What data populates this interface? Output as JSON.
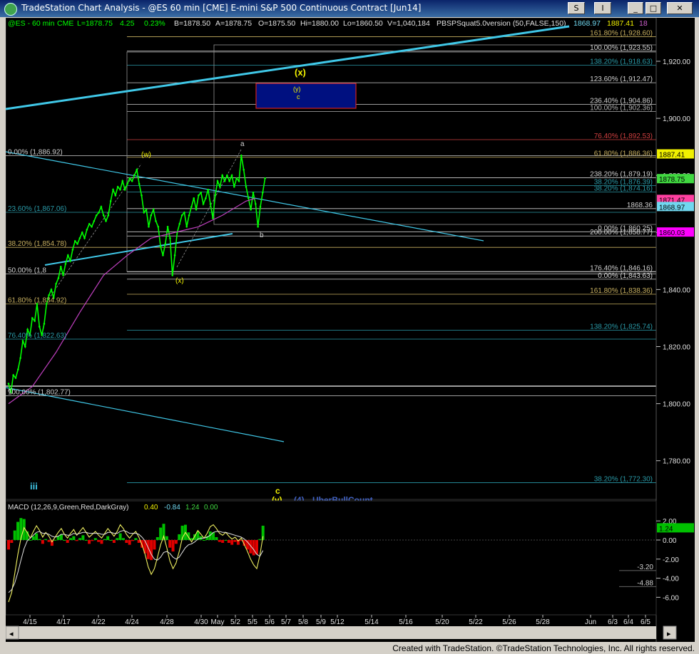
{
  "window": {
    "title": "TradeStation Chart Analysis - @ES 60 min [CME] E-mini S&P 500 Continuous Contract [Jun14]",
    "buttons": {
      "s": "S",
      "i": "I",
      "minimize": "_",
      "restore": "□",
      "close": "✕"
    }
  },
  "header": {
    "symbol": "@ES - 60 min",
    "exchange": "CME",
    "last": "L=1878.75",
    "change": "4.25",
    "pct": "0.23%",
    "bid": "B=1878.50",
    "ask": "A=1878.75",
    "open": "O=1875.50",
    "high": "Hi=1880.00",
    "low": "Lo=1860.50",
    "volume": "V=1,040,184",
    "indicator": "PBSPSquat5.0version (50,FALSE,150)",
    "r1": "1868.97",
    "r2": "1887.41",
    "r3": "18"
  },
  "footer": "Created with TradeStation. ©TradeStation Technologies, Inc. All rights reserved.",
  "colors": {
    "bg": "#000000",
    "price": "#00ff00",
    "cyan": "#40c8e8",
    "fib": "#2a9aa8",
    "tan": "#d4c890",
    "magenta": "#c040c0",
    "yellow": "#f0f000",
    "navy": "#001080"
  },
  "chart_data": [
    {
      "type": "line",
      "title": "@ES - 60 min",
      "x_tick_labels": [
        "4/15",
        "4/17",
        "4/22",
        "4/24",
        "4/28",
        "4/30",
        "May",
        "5/2",
        "5/5",
        "5/6",
        "5/7",
        "5/8",
        "5/9",
        "5/12",
        "5/14",
        "5/16",
        "5/20",
        "5/22",
        "5/26",
        "5/28",
        "Jun",
        "6/3",
        "6/4",
        "6/5"
      ],
      "y_axis": {
        "ylim": [
          1766,
          1932
        ],
        "ticks": [
          "1,920.00",
          "1,900.00",
          "1,880.00",
          "1,860.00",
          "1,840.00",
          "1,820.00",
          "1,800.00",
          "1,780.00"
        ]
      },
      "series": [
        {
          "name": "@ES 60 min",
          "points": [
            [
              0,
              1807
            ],
            [
              1,
              1804
            ],
            [
              2,
              1810
            ],
            [
              3,
              1809
            ],
            [
              4,
              1812
            ],
            [
              5,
              1816
            ],
            [
              6,
              1822
            ],
            [
              7,
              1820
            ],
            [
              8,
              1826
            ],
            [
              9,
              1824
            ],
            [
              10,
              1830
            ],
            [
              11,
              1829
            ],
            [
              12,
              1835
            ],
            [
              13,
              1827
            ],
            [
              14,
              1824
            ],
            [
              15,
              1828
            ],
            [
              16,
              1835
            ],
            [
              17,
              1838
            ],
            [
              18,
              1840
            ],
            [
              19,
              1837
            ],
            [
              20,
              1842
            ],
            [
              21,
              1844
            ],
            [
              22,
              1848
            ],
            [
              23,
              1845
            ],
            [
              24,
              1849
            ],
            [
              25,
              1852
            ],
            [
              26,
              1850
            ],
            [
              27,
              1854
            ],
            [
              28,
              1857
            ],
            [
              29,
              1856
            ],
            [
              30,
              1858
            ],
            [
              31,
              1860
            ],
            [
              32,
              1858
            ],
            [
              33,
              1861
            ],
            [
              34,
              1863
            ],
            [
              35,
              1862
            ],
            [
              36,
              1864
            ],
            [
              37,
              1866
            ],
            [
              38,
              1867
            ],
            [
              39,
              1869
            ],
            [
              40,
              1866
            ],
            [
              41,
              1864
            ],
            [
              42,
              1866
            ],
            [
              43,
              1871
            ],
            [
              44,
              1875
            ],
            [
              45,
              1873
            ],
            [
              46,
              1876
            ],
            [
              47,
              1875
            ],
            [
              48,
              1878
            ],
            [
              49,
              1875
            ],
            [
              50,
              1877
            ],
            [
              51,
              1879
            ],
            [
              52,
              1878
            ],
            [
              53,
              1880
            ],
            [
              54,
              1882
            ],
            [
              55,
              1877
            ],
            [
              56,
              1873
            ],
            [
              57,
              1867
            ],
            [
              58,
              1868
            ],
            [
              59,
              1862
            ],
            [
              60,
              1866
            ],
            [
              61,
              1868
            ],
            [
              62,
              1864
            ],
            [
              63,
              1862
            ],
            [
              64,
              1855
            ],
            [
              65,
              1852
            ],
            [
              66,
              1856
            ],
            [
              67,
              1862
            ],
            [
              68,
              1858
            ],
            [
              69,
              1845
            ],
            [
              70,
              1852
            ],
            [
              71,
              1860
            ],
            [
              72,
              1863
            ],
            [
              73,
              1866
            ],
            [
              74,
              1867
            ],
            [
              75,
              1862
            ],
            [
              76,
              1866
            ],
            [
              77,
              1869
            ],
            [
              78,
              1872
            ],
            [
              79,
              1868
            ],
            [
              80,
              1873
            ],
            [
              81,
              1874
            ],
            [
              82,
              1870
            ],
            [
              83,
              1872
            ],
            [
              84,
              1875
            ],
            [
              85,
              1870
            ],
            [
              86,
              1865
            ],
            [
              87,
              1873
            ],
            [
              88,
              1878
            ],
            [
              89,
              1876
            ],
            [
              90,
              1880
            ],
            [
              91,
              1878
            ],
            [
              92,
              1880
            ],
            [
              93,
              1878
            ],
            [
              94,
              1880
            ],
            [
              95,
              1876
            ],
            [
              96,
              1879
            ],
            [
              97,
              1878
            ],
            [
              98,
              1887
            ],
            [
              99,
              1882
            ],
            [
              100,
              1876
            ],
            [
              101,
              1872
            ],
            [
              102,
              1868
            ],
            [
              103,
              1874
            ],
            [
              104,
              1870
            ],
            [
              105,
              1862
            ],
            [
              106,
              1869
            ],
            [
              107,
              1874
            ],
            [
              108,
              1879
            ]
          ]
        },
        {
          "name": "MA",
          "points": [
            [
              0,
              1800
            ],
            [
              10,
              1806
            ],
            [
              20,
              1818
            ],
            [
              30,
              1832
            ],
            [
              40,
              1845
            ],
            [
              50,
              1852
            ],
            [
              60,
              1858
            ],
            [
              70,
              1860
            ],
            [
              80,
              1862
            ],
            [
              90,
              1866
            ],
            [
              100,
              1871
            ],
            [
              104,
              1872
            ]
          ]
        }
      ],
      "right_labels": [
        {
          "text": "1887.41",
          "value": 1887.41,
          "color": "#f0f000"
        },
        {
          "text": "1878.75",
          "value": 1878.75,
          "color": "#40d840"
        },
        {
          "text": "1871.47",
          "value": 1871.47,
          "color": "#ff40a0"
        },
        {
          "text": "1868.97",
          "value": 1868.97,
          "color": "#70d8f0"
        },
        {
          "text": "1860.03",
          "value": 1860.03,
          "color": "#ff00ff"
        }
      ],
      "fib_levels": [
        {
          "text": "161.80% (1,928.60)",
          "value": 1928.6,
          "color": "#c8b060",
          "side": "right"
        },
        {
          "text": "100.00% (1,923.55)",
          "value": 1923.55,
          "color": "#d0d0d0",
          "side": "right"
        },
        {
          "text": "138.20% (1,918.63)",
          "value": 1918.63,
          "color": "#2a9aa8",
          "side": "right"
        },
        {
          "text": "123.60% (1,912.47)",
          "value": 1912.47,
          "color": "#d0d0d0",
          "side": "right"
        },
        {
          "text": "236.40% (1,904.86)",
          "value": 1904.86,
          "color": "#d0d0d0",
          "side": "right"
        },
        {
          "text": "100.00% (1,902.36)",
          "value": 1902.36,
          "color": "#b0b0b0",
          "side": "right"
        },
        {
          "text": "76.40% (1,892.53)",
          "value": 1892.53,
          "color": "#d04040",
          "side": "right"
        },
        {
          "text": "61.80% (1,886.36)",
          "value": 1886.36,
          "color": "#c8b060",
          "side": "right"
        },
        {
          "text": "238.20% (1,879.19)",
          "value": 1879.19,
          "color": "#d0d0d0",
          "side": "right"
        },
        {
          "text": "38.20% (1,876.39)",
          "value": 1876.39,
          "color": "#2a9aa8",
          "side": "right"
        },
        {
          "text": "38.20% (1,874.16)",
          "value": 1874.16,
          "color": "#2a9aa8",
          "side": "right"
        },
        {
          "text": "1868.36",
          "value": 1868.36,
          "color": "#d0d0d0",
          "side": "right"
        },
        {
          "text": "0.00% (1,860.25)",
          "value": 1860.25,
          "color": "#d0d0d0",
          "side": "right"
        },
        {
          "text": "200.00% (1,858.77)",
          "value": 1858.77,
          "color": "#d0d0d0",
          "side": "right"
        },
        {
          "text": "176.40% (1,846.16)",
          "value": 1846.16,
          "color": "#d0d0d0",
          "side": "right"
        },
        {
          "text": "0.00% (1,843.63)",
          "value": 1843.63,
          "color": "#d0d0d0",
          "side": "right"
        },
        {
          "text": "161.80% (1,838.36)",
          "value": 1838.36,
          "color": "#c8b060",
          "side": "right"
        },
        {
          "text": "138.20% (1,825.74)",
          "value": 1825.74,
          "color": "#2a9aa8",
          "side": "right"
        },
        {
          "text": "38.20% (1,772.30)",
          "value": 1772.3,
          "color": "#2a9aa8",
          "side": "right"
        },
        {
          "text": "0.00% (1,886.92)",
          "value": 1886.92,
          "color": "#d0d0d0",
          "side": "left"
        },
        {
          "text": "23.60% (1,867.06)",
          "value": 1867.06,
          "color": "#2a9aa8",
          "side": "left"
        },
        {
          "text": "38.20% (1,854.78)",
          "value": 1854.78,
          "color": "#c8b060",
          "side": "left"
        },
        {
          "text": "50.00% (1,8",
          "value": 1845.5,
          "color": "#d0d0d0",
          "side": "left"
        },
        {
          "text": "61.80% (1,834.92)",
          "value": 1834.92,
          "color": "#c8b060",
          "side": "left"
        },
        {
          "text": "76.40% (1,822.63)",
          "value": 1822.63,
          "color": "#2a9aa8",
          "side": "left"
        },
        {
          "text": "100.00% (1,802.77)",
          "value": 1802.77,
          "color": "#d0d0d0",
          "side": "left"
        }
      ],
      "wave_labels": [
        {
          "text": "(w)",
          "color": "#f0f000"
        },
        {
          "text": "(x)",
          "color": "#f0f000"
        },
        {
          "text": "(x)",
          "color": "#f0f000"
        },
        {
          "text": "(y)",
          "color": "#f0f000"
        },
        {
          "text": "c",
          "color": "#f0f000"
        },
        {
          "text": "a",
          "color": "#d0d0d0"
        },
        {
          "text": "b",
          "color": "#d0d0d0"
        },
        {
          "text": "c)",
          "color": "#d0d0d0"
        },
        {
          "text": "iii",
          "color": "#40c8e8"
        },
        {
          "text": "c",
          "color": "#f0f000"
        },
        {
          "text": "(v)",
          "color": "#f0f000"
        },
        {
          "text": "(4)",
          "color": "#4060c0"
        },
        {
          "text": "UberBullCount",
          "color": "#4060c0"
        }
      ]
    },
    {
      "type": "line",
      "title": "MACD (12,26,9,Green,Red,DarkGray)",
      "values_text": [
        "0.40",
        "-0.84",
        "1.24",
        "0.00"
      ],
      "y_axis": {
        "ylim": [
          -7,
          3
        ],
        "ticks": [
          "2.00",
          "0.00",
          "-2.00",
          "-4.00",
          "-6.00"
        ]
      },
      "right_labels": [
        {
          "text": "1.24",
          "value": 1.24,
          "color": "#00c000"
        },
        {
          "text": "-3.20",
          "value": -3.2,
          "color": "#d0d0d0"
        },
        {
          "text": "-4.88",
          "value": -4.88,
          "color": "#d0d0d0"
        }
      ],
      "series": [
        {
          "name": "MACD",
          "values": [
            -6.5,
            -5.5,
            -3.5,
            -1.5,
            0.2,
            1.3,
            0.8,
            0.2,
            0.9,
            1.5,
            1.0,
            0.3,
            0.8,
            0.4,
            -0.2,
            0.3,
            0.8,
            1.2,
            0.6,
            0.2,
            0.7,
            1.1,
            0.5,
            0.9,
            1.3,
            0.8,
            0.3,
            0.6,
            0.9,
            0.5,
            0.2,
            0.7,
            1.2,
            0.8,
            0.4,
            0.9,
            1.6,
            1.2,
            0.6,
            0.2,
            0.6,
            0.9,
            0.3,
            -0.5,
            -1.5,
            -2.8,
            -3.6,
            -3.0,
            -1.8,
            -0.5,
            0.4,
            -0.8,
            -2.2,
            -3.0,
            -2.4,
            -1.2,
            0.2,
            0.8,
            0.3,
            -0.2,
            0.4,
            1.0,
            0.6,
            0.2,
            0.7,
            1.4,
            1.6,
            1.2,
            0.7,
            0.5,
            0.8,
            0.4,
            0.1,
            0.3,
            -0.1,
            0.2,
            -0.5,
            -1.2,
            -2.0,
            -2.6,
            -3.0,
            -1.6,
            0.4
          ]
        },
        {
          "name": "Avg",
          "values": [
            -5.5,
            -5.2,
            -4.5,
            -3.4,
            -2.1,
            -0.9,
            -0.1,
            0.2,
            0.5,
            0.8,
            0.9,
            0.7,
            0.7,
            0.6,
            0.4,
            0.3,
            0.4,
            0.6,
            0.6,
            0.5,
            0.5,
            0.7,
            0.6,
            0.7,
            0.8,
            0.8,
            0.7,
            0.7,
            0.7,
            0.7,
            0.6,
            0.6,
            0.8,
            0.8,
            0.7,
            0.7,
            0.9,
            1.0,
            0.9,
            0.7,
            0.7,
            0.7,
            0.6,
            0.3,
            -0.1,
            -0.8,
            -1.5,
            -2.0,
            -2.1,
            -1.8,
            -1.3,
            -1.2,
            -1.4,
            -1.8,
            -2.0,
            -1.8,
            -1.3,
            -0.8,
            -0.5,
            -0.4,
            -0.2,
            0.1,
            0.2,
            0.2,
            0.3,
            0.5,
            0.8,
            0.9,
            0.9,
            0.8,
            0.8,
            0.7,
            0.6,
            0.5,
            0.4,
            0.3,
            0.1,
            -0.2,
            -0.6,
            -1.0,
            -1.5,
            -1.7,
            -1.1
          ]
        }
      ]
    }
  ]
}
